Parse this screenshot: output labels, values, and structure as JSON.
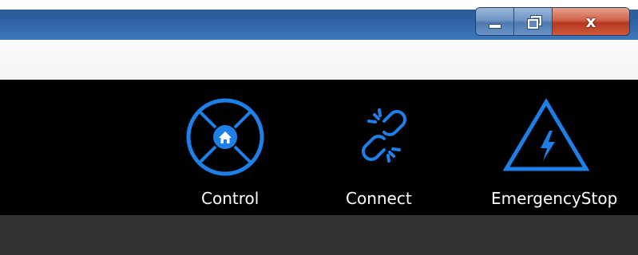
{
  "window": {
    "controls": {
      "minimize_icon": "minimize-icon",
      "maximize_icon": "restore-icon",
      "close_glyph": "x"
    }
  },
  "toolbar": {
    "accent_color": "#1e7fe6",
    "background_color": "#000000",
    "items": [
      {
        "label": "Control",
        "icon": "home-target-icon"
      },
      {
        "label": "Connect",
        "icon": "broken-link-icon"
      },
      {
        "label": "EmergencyStop",
        "icon": "warning-lightning-icon"
      }
    ]
  },
  "content": {
    "background_color": "#333333"
  }
}
